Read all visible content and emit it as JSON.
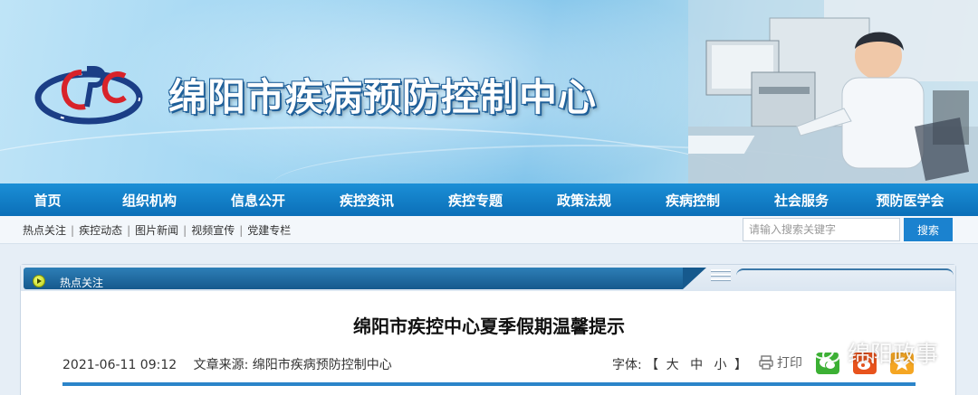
{
  "header": {
    "site_title": "绵阳市疾病预防控制中心",
    "logo_name": "cdc-logo"
  },
  "main_nav": {
    "items": [
      "首页",
      "组织机构",
      "信息公开",
      "疾控资讯",
      "疾控专题",
      "政策法规",
      "疾病控制",
      "社会服务",
      "预防医学会"
    ]
  },
  "sub_nav": {
    "links": [
      "热点关注",
      "疾控动态",
      "图片新闻",
      "视频宣传",
      "党建专栏"
    ],
    "separator": "|"
  },
  "search": {
    "placeholder": "请输入搜索关键字",
    "button_label": "搜索"
  },
  "panel": {
    "tab_label": "热点关注"
  },
  "article": {
    "title": "绵阳市疾控中心夏季假期温馨提示",
    "datetime": "2021-06-11 09:12",
    "source_label": "文章来源:",
    "source": "绵阳市疾病预防控制中心",
    "font_label": "字体:",
    "font_open": "【",
    "font_sizes": [
      "大",
      "中",
      "小"
    ],
    "font_close": "】",
    "print_label": "打印"
  },
  "watermark": {
    "text": "绵阳政事"
  },
  "colors": {
    "nav_bg": "#0b6fb8",
    "accent": "#2b84c9",
    "wechat": "#3cb034",
    "weibo": "#e8531d",
    "qzone": "#f5a623"
  }
}
